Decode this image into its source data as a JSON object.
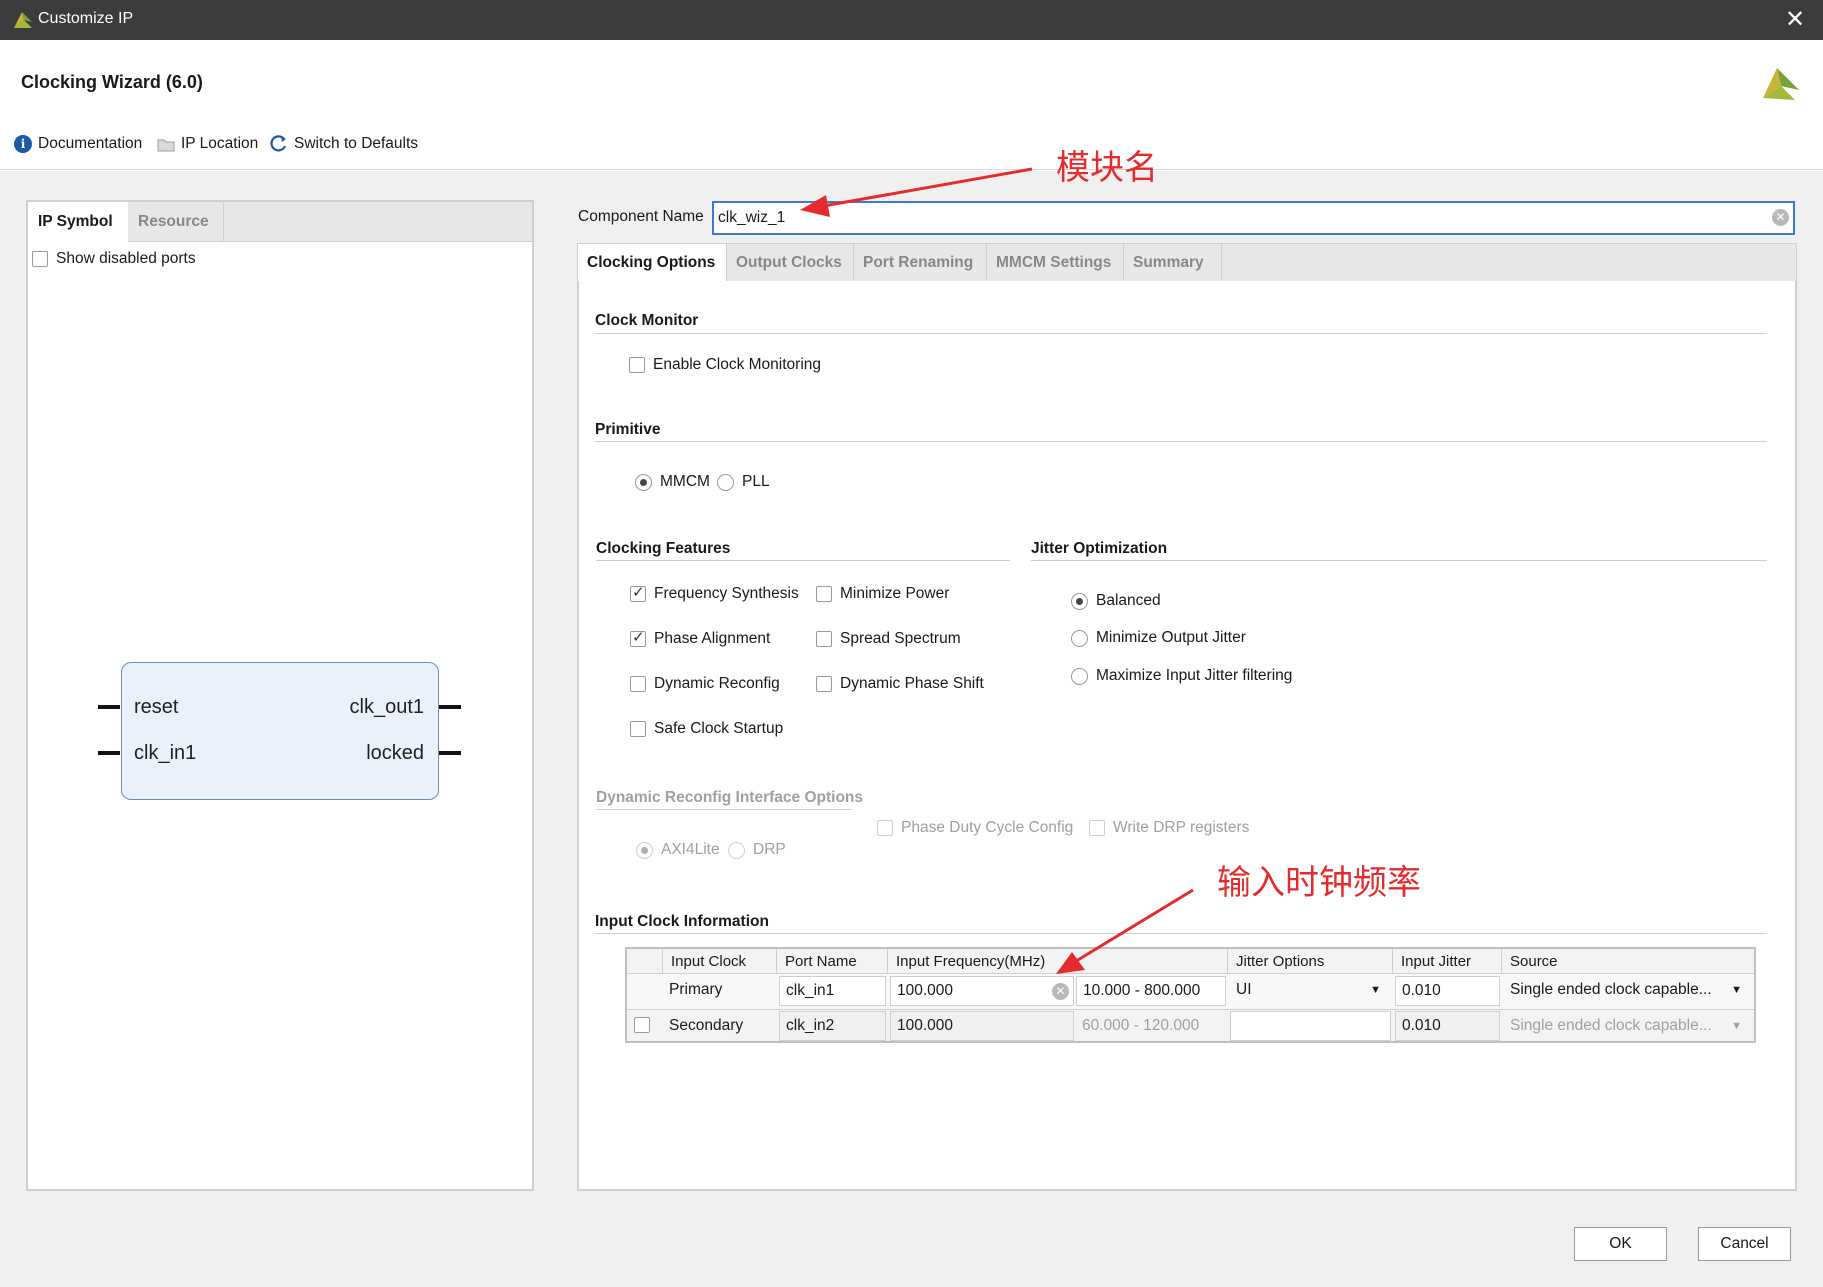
{
  "window": {
    "title": "Customize IP",
    "close_glyph": "✕"
  },
  "header": {
    "wizard_title": "Clocking Wizard (6.0)",
    "toolbar": {
      "documentation": "Documentation",
      "ip_location": "IP Location",
      "switch_defaults": "Switch to Defaults"
    }
  },
  "left_panel": {
    "tabs": [
      "IP Symbol",
      "Resource"
    ],
    "show_disabled_ports": "Show disabled ports",
    "symbol": {
      "left_ports": [
        "reset",
        "clk_in1"
      ],
      "right_ports": [
        "clk_out1",
        "locked"
      ]
    }
  },
  "component": {
    "label": "Component Name",
    "value": "clk_wiz_1"
  },
  "right_tabs": [
    "Clocking Options",
    "Output Clocks",
    "Port Renaming",
    "MMCM Settings",
    "Summary"
  ],
  "clock_monitor": {
    "title": "Clock Monitor",
    "enable": "Enable Clock Monitoring"
  },
  "primitive": {
    "title": "Primitive",
    "options": [
      "MMCM",
      "PLL"
    ],
    "selected": "MMCM"
  },
  "clocking_features": {
    "title": "Clocking Features",
    "col1": [
      "Frequency Synthesis",
      "Phase Alignment",
      "Dynamic Reconfig",
      "Safe Clock Startup"
    ],
    "col2": [
      "Minimize Power",
      "Spread Spectrum",
      "Dynamic Phase Shift"
    ]
  },
  "jitter_opt": {
    "title": "Jitter Optimization",
    "options": [
      "Balanced",
      "Minimize Output Jitter",
      "Maximize Input Jitter filtering"
    ],
    "selected": "Balanced"
  },
  "drp": {
    "title": "Dynamic Reconfig Interface Options",
    "radios": [
      "AXI4Lite",
      "DRP"
    ],
    "checks": [
      "Phase Duty Cycle Config",
      "Write DRP registers"
    ]
  },
  "input_clock": {
    "title": "Input Clock Information",
    "headers": [
      "Input Clock",
      "Port Name",
      "Input Frequency(MHz)",
      "Jitter Options",
      "Input Jitter",
      "Source"
    ],
    "rows": [
      {
        "clock": "Primary",
        "port": "clk_in1",
        "freq": "100.000",
        "range": "10.000 - 800.000",
        "jitter_opt": "UI",
        "jitter": "0.010",
        "source": "Single ended clock capable..."
      },
      {
        "clock": "Secondary",
        "port": "clk_in2",
        "freq": "100.000",
        "range": "60.000 - 120.000",
        "jitter_opt": "",
        "jitter": "0.010",
        "source": "Single ended clock capable..."
      }
    ]
  },
  "buttons": {
    "ok": "OK",
    "cancel": "Cancel"
  },
  "annotations": {
    "module_name": "模块名",
    "input_freq": "输入时钟频率",
    "color": "#e52b2b"
  }
}
